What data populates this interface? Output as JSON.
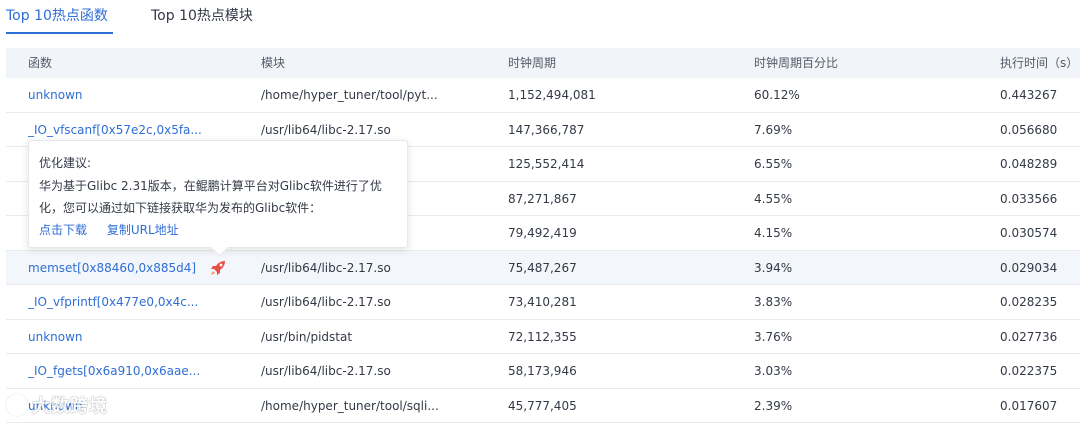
{
  "tabs": [
    {
      "label": "Top 10热点函数",
      "active": true
    },
    {
      "label": "Top 10热点模块",
      "active": false
    }
  ],
  "accent_color": "#2f6ed6",
  "table": {
    "headers": [
      "函数",
      "模块",
      "时钟周期",
      "时钟周期百分比",
      "执行时间（s）"
    ],
    "rows": [
      {
        "func": "unknown",
        "module": "/home/hyper_tuner/tool/pyt...",
        "clock": "1,152,494,081",
        "pct": "60.12%",
        "time": "0.443267"
      },
      {
        "func": "_IO_vfscanf[0x57e2c,0x5fa...",
        "module": "/usr/lib64/libc-2.17.so",
        "clock": "147,366,787",
        "pct": "7.69%",
        "time": "0.056680"
      },
      {
        "func": "",
        "module": "",
        "clock": "125,552,414",
        "pct": "6.55%",
        "time": "0.048289"
      },
      {
        "func": "",
        "module": "",
        "clock": "87,271,867",
        "pct": "4.55%",
        "time": "0.033566"
      },
      {
        "func": "",
        "module": "",
        "clock": "79,492,419",
        "pct": "4.15%",
        "time": "0.030574"
      },
      {
        "func": "memset[0x88460,0x885d4]",
        "module": "/usr/lib64/libc-2.17.so",
        "clock": "75,487,267",
        "pct": "3.94%",
        "time": "0.029034",
        "icon": "rocket-icon"
      },
      {
        "func": "_IO_vfprintf[0x477e0,0x4c...",
        "module": "/usr/lib64/libc-2.17.so",
        "clock": "73,410,281",
        "pct": "3.83%",
        "time": "0.028235"
      },
      {
        "func": "unknown",
        "module": "/usr/bin/pidstat",
        "clock": "72,112,355",
        "pct": "3.76%",
        "time": "0.027736"
      },
      {
        "func": "_IO_fgets[0x6a910,0x6aae...",
        "module": "/usr/lib64/libc-2.17.so",
        "clock": "58,173,946",
        "pct": "3.03%",
        "time": "0.022375"
      },
      {
        "func": "unknown",
        "module": "/home/hyper_tuner/tool/sqli...",
        "clock": "45,777,405",
        "pct": "2.39%",
        "time": "0.017607"
      }
    ]
  },
  "tooltip": {
    "title": "优化建议:",
    "body": "华为基于Glibc 2.31版本，在鲲鹏计算平台对Glibc软件进行了优化，您可以通过如下链接获取华为发布的Glibc软件：",
    "link_download": "点击下载",
    "link_copy": "复制URL地址"
  },
  "watermark": {
    "text": "大数跨境"
  }
}
